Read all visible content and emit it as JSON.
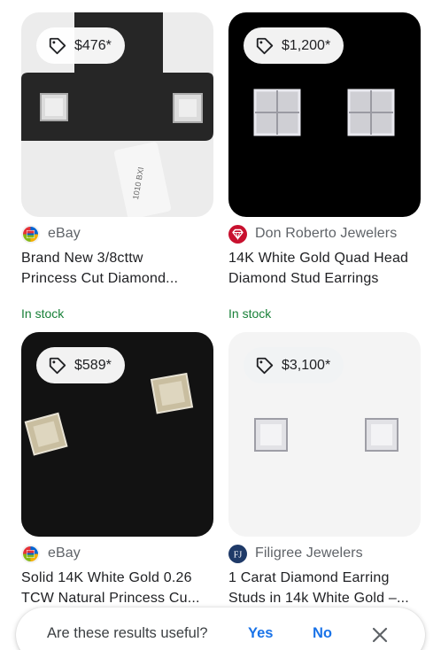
{
  "products": [
    {
      "price": "$476*",
      "seller": "eBay",
      "title_line1": "Brand New 3/8cttw",
      "title_line2": "Princess Cut Diamond...",
      "stock": "In stock"
    },
    {
      "price": "$1,200*",
      "seller": "Don Roberto Jewelers",
      "title_line1": "14K White Gold Quad Head",
      "title_line2": "Diamond Stud Earrings",
      "stock": "In stock"
    },
    {
      "price": "$589*",
      "seller": "eBay",
      "title_line1": "Solid 14K White Gold 0.26",
      "title_line2": "TCW Natural Princess Cu..."
    },
    {
      "price": "$3,100*",
      "seller": "Filigree Jewelers",
      "seller_logo_text": "FJ",
      "title_line1": "1 Carat Diamond Earring",
      "title_line2": "Studs in 14k White Gold –..."
    }
  ],
  "feedback": {
    "question": "Are these results useful?",
    "yes": "Yes",
    "no": "No"
  },
  "colors": {
    "link_blue": "#1a73e8",
    "stock_green": "#188038",
    "seller_gray": "#5f6368"
  },
  "icons": [
    "price-tag-icon",
    "ebay-logo",
    "don-roberto-gem-logo",
    "filigree-logo",
    "close-icon"
  ]
}
